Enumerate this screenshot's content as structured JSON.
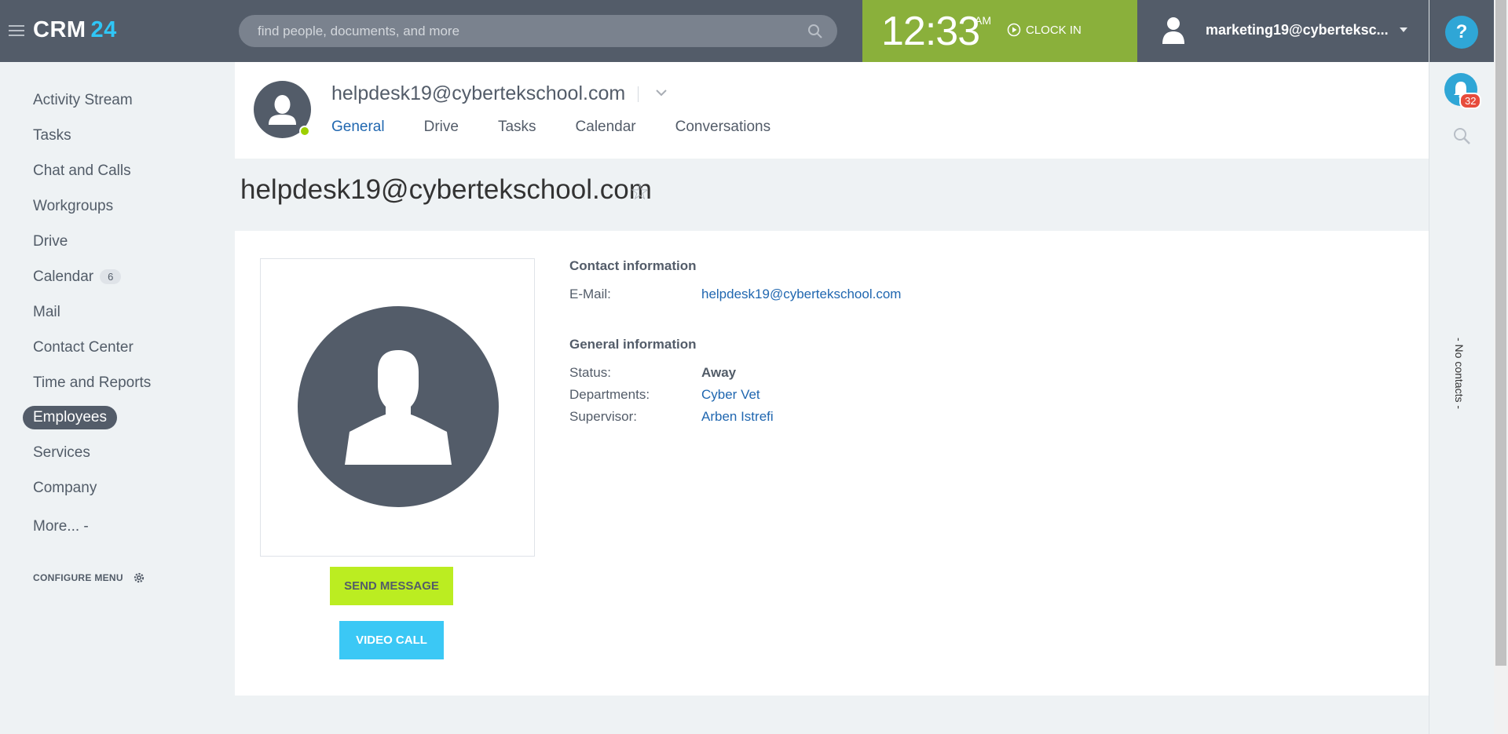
{
  "app": {
    "logo_text": "CRM",
    "logo_num": "24"
  },
  "search": {
    "placeholder": "find people, documents, and more"
  },
  "clock": {
    "time": "12:33",
    "ampm": "AM",
    "clock_in_label": "CLOCK IN"
  },
  "user": {
    "name": "marketing19@cyberteksc..."
  },
  "rightpanel": {
    "help_label": "?",
    "notifications_count": "32",
    "no_contacts_label": "- No contacts -"
  },
  "sidebar": {
    "items": [
      {
        "label": "Activity Stream"
      },
      {
        "label": "Tasks"
      },
      {
        "label": "Chat and Calls"
      },
      {
        "label": "Workgroups"
      },
      {
        "label": "Drive"
      },
      {
        "label": "Calendar",
        "badge": "6"
      },
      {
        "label": "Mail"
      },
      {
        "label": "Contact Center"
      },
      {
        "label": "Time and Reports"
      },
      {
        "label": "Employees"
      },
      {
        "label": "Services"
      },
      {
        "label": "Company"
      },
      {
        "label": "More... -"
      }
    ],
    "configure_label": "CONFIGURE MENU"
  },
  "profile_header": {
    "title": "helpdesk19@cybertekschool.com",
    "tabs": [
      "General",
      "Drive",
      "Tasks",
      "Calendar",
      "Conversations"
    ]
  },
  "page": {
    "title": "helpdesk19@cybertekschool.com",
    "star": "☆"
  },
  "profile": {
    "send_message_label": "SEND MESSAGE",
    "video_call_label": "VIDEO CALL",
    "contact_heading": "Contact information",
    "email_label": "E-Mail:",
    "email_value": "helpdesk19@cybertekschool.com",
    "general_heading": "General information",
    "status_label": "Status:",
    "status_value": "Away",
    "departments_label": "Departments:",
    "departments_value": "Cyber Vet",
    "supervisor_label": "Supervisor:",
    "supervisor_value": "Arben Istrefi"
  },
  "colors": {
    "topbar": "#535c69",
    "clock_bg": "#8ab03b",
    "accent_blue": "#2067b0",
    "send_button": "#bbed21",
    "video_button": "#3bc8f5",
    "online_dot": "#9dcf00"
  }
}
